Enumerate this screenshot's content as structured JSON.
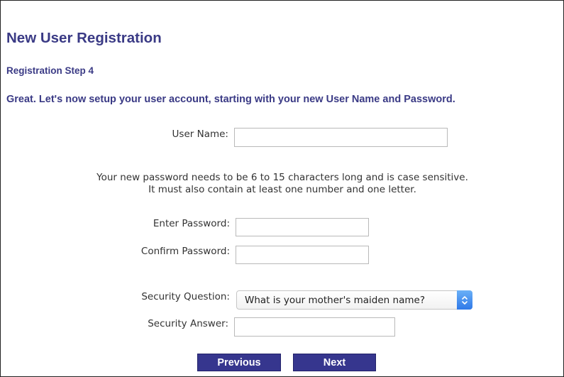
{
  "header": {
    "title": "New User Registration",
    "step": "Registration Step 4",
    "intro": "Great. Let's now setup your user account, starting with your new User Name and Password."
  },
  "form": {
    "username": {
      "label": "User Name:",
      "value": ""
    },
    "password_note": {
      "line1": "Your new password needs to be 6 to 15 characters long and is case sensitive.",
      "line2": "It must also contain at least one number and one letter."
    },
    "password": {
      "label": "Enter Password:",
      "value": ""
    },
    "confirm_password": {
      "label": "Confirm Password:",
      "value": ""
    },
    "security_question": {
      "label": "Security Question:",
      "selected": "What is your mother's maiden name?"
    },
    "security_answer": {
      "label": "Security Answer:",
      "value": ""
    }
  },
  "buttons": {
    "previous": "Previous",
    "next": "Next"
  },
  "colors": {
    "heading": "#3a3a85",
    "button": "#36368e",
    "select_arrow": "#2f79e8"
  },
  "icons": {
    "select_arrow": "chevron-up-down-icon"
  }
}
